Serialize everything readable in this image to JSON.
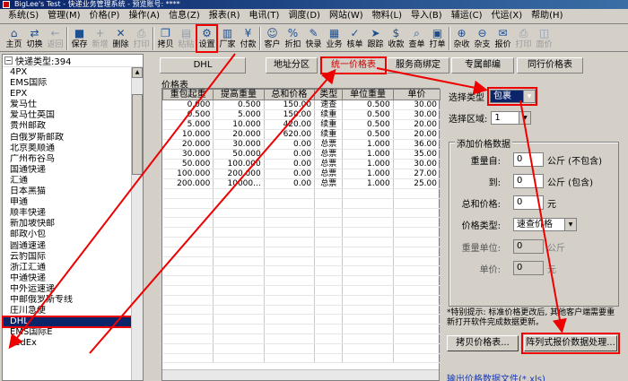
{
  "window": {
    "title": "BigLee's Test - 快递业务管理系统 - 预览账号: ****"
  },
  "menu": [
    "系统(S)",
    "管理(M)",
    "价格(P)",
    "操作(A)",
    "信息(Z)",
    "报表(R)",
    "电讯(T)",
    "调度(D)",
    "网站(W)",
    "物料(L)",
    "导入(B)",
    "辅运(C)",
    "代运(X)",
    "帮助(H)"
  ],
  "toolbar": [
    {
      "label": "主页",
      "icon": "home-icon",
      "disabled": false
    },
    {
      "label": "切换",
      "icon": "switch-icon",
      "disabled": false
    },
    {
      "label": "返回",
      "icon": "back-icon",
      "disabled": true
    },
    {
      "sep": true
    },
    {
      "label": "保存",
      "icon": "save-icon",
      "disabled": false
    },
    {
      "label": "新增",
      "icon": "add-icon",
      "disabled": true
    },
    {
      "label": "删除",
      "icon": "delete-icon",
      "disabled": false
    },
    {
      "label": "打印",
      "icon": "print-icon",
      "disabled": true
    },
    {
      "sep": true
    },
    {
      "label": "拷贝",
      "icon": "copy-icon",
      "disabled": false
    },
    {
      "label": "粘贴",
      "icon": "paste-icon",
      "disabled": true
    },
    {
      "label": "设置",
      "icon": "settings-icon",
      "disabled": false,
      "highlight": true
    },
    {
      "label": "厂家",
      "icon": "factory-icon",
      "disabled": false
    },
    {
      "label": "付款",
      "icon": "payment-icon",
      "disabled": false
    },
    {
      "sep": true
    },
    {
      "label": "客户",
      "icon": "customer-icon",
      "disabled": false
    },
    {
      "label": "折扣",
      "icon": "discount-icon",
      "disabled": false
    },
    {
      "label": "快录",
      "icon": "quick-entry-icon",
      "disabled": false
    },
    {
      "label": "业务",
      "icon": "business-icon",
      "disabled": false
    },
    {
      "label": "核单",
      "icon": "verify-icon",
      "disabled": false
    },
    {
      "label": "跟踪",
      "icon": "track-icon",
      "disabled": false
    },
    {
      "label": "收款",
      "icon": "receive-icon",
      "disabled": false
    },
    {
      "label": "查单",
      "icon": "query-icon",
      "disabled": false
    },
    {
      "label": "打单",
      "icon": "print-bill-icon",
      "disabled": false
    },
    {
      "sep": true
    },
    {
      "label": "杂收",
      "icon": "misc-income-icon",
      "disabled": false
    },
    {
      "label": "杂支",
      "icon": "misc-expense-icon",
      "disabled": false
    },
    {
      "label": "报价",
      "icon": "quote-icon",
      "disabled": false
    },
    {
      "label": "打印",
      "icon": "print-icon",
      "disabled": true
    },
    {
      "label": "面价",
      "icon": "face-price-icon",
      "disabled": true
    }
  ],
  "left_panel": {
    "header": "快递类型:394",
    "carriers": [
      "4PX",
      "EMS国际",
      "EPX",
      "爱马仕",
      "爱马仕英国",
      "贵州邮政",
      "白俄罗斯邮政",
      "北京奥顺通",
      "广州布谷鸟",
      "国通快递",
      "汇通",
      "日本黑猫",
      "申通",
      "顺丰快递",
      "新加坡快邮",
      "邮政小包",
      "圆通速递",
      "云豹国际",
      "浙江汇通",
      "中通快递",
      "中外运速递",
      "中邮俄罗斯专线",
      "庄川急便",
      "DHL",
      "EMS国际E",
      "FedEx"
    ],
    "selected": "DHL"
  },
  "tabs": [
    {
      "label": "DHL",
      "highlight": false
    },
    {
      "label": "地址分区",
      "highlight": false
    },
    {
      "label": "统一价格表",
      "highlight": true
    },
    {
      "label": "服务商绑定",
      "highlight": false
    },
    {
      "label": "专属邮编",
      "highlight": false
    },
    {
      "label": "同行价格表",
      "highlight": false
    }
  ],
  "grid": {
    "title": "价格表",
    "columns": [
      "重包起重",
      "提高重量",
      "总和价格",
      "类型",
      "单位重量",
      "单价"
    ],
    "rows": [
      [
        "0.000",
        "0.500",
        "150.00",
        "速查",
        "0.500",
        "30.00"
      ],
      [
        "0.500",
        "5.000",
        "150.00",
        "续重",
        "0.500",
        "30.00"
      ],
      [
        "5.000",
        "10.000",
        "420.00",
        "续重",
        "0.500",
        "20.00"
      ],
      [
        "10.000",
        "20.000",
        "620.00",
        "续重",
        "0.500",
        "20.00"
      ],
      [
        "20.000",
        "30.000",
        "0.00",
        "总票",
        "1.000",
        "36.00"
      ],
      [
        "30.000",
        "50.000",
        "0.00",
        "总票",
        "1.000",
        "35.00"
      ],
      [
        "50.000",
        "100.000",
        "0.00",
        "总票",
        "1.000",
        "30.00"
      ],
      [
        "100.000",
        "200.000",
        "0.00",
        "总票",
        "1.000",
        "27.00"
      ],
      [
        "200.000",
        "10000...",
        "0.00",
        "总票",
        "1.000",
        "25.00"
      ]
    ]
  },
  "form": {
    "type_label": "选择类型",
    "type_value": "包裹",
    "region_label": "选择区域:",
    "region_value": "1",
    "group_title": "添加价格数据",
    "weight_from_label": "重量自:",
    "weight_from_value": "0",
    "weight_from_unit": "公斤 (不包含)",
    "weight_to_label": "到:",
    "weight_to_value": "0",
    "weight_to_unit": "公斤 (包含)",
    "total_label": "总和价格:",
    "total_value": "0",
    "total_unit": "元",
    "price_type_label": "价格类型:",
    "price_type_value": "速查价格",
    "unit_weight_label": "重量单位:",
    "unit_weight_value": "0",
    "unit_weight_unit": "公斤",
    "unit_price_label": "单价:",
    "unit_price_value": "0",
    "unit_price_unit": "元",
    "hint": "*特别提示: 标准价格更改后, 其他客户端需要重新打开软件完成数据更新。",
    "copy_button": "拷贝价格表...",
    "array_button": "阵列式报价数据处理...",
    "export_link": "输出价格数据文件(*.xls)"
  },
  "colors": {
    "highlight": "#ee0000",
    "selection": "#0a246a",
    "titlebar": "#0a246a"
  }
}
